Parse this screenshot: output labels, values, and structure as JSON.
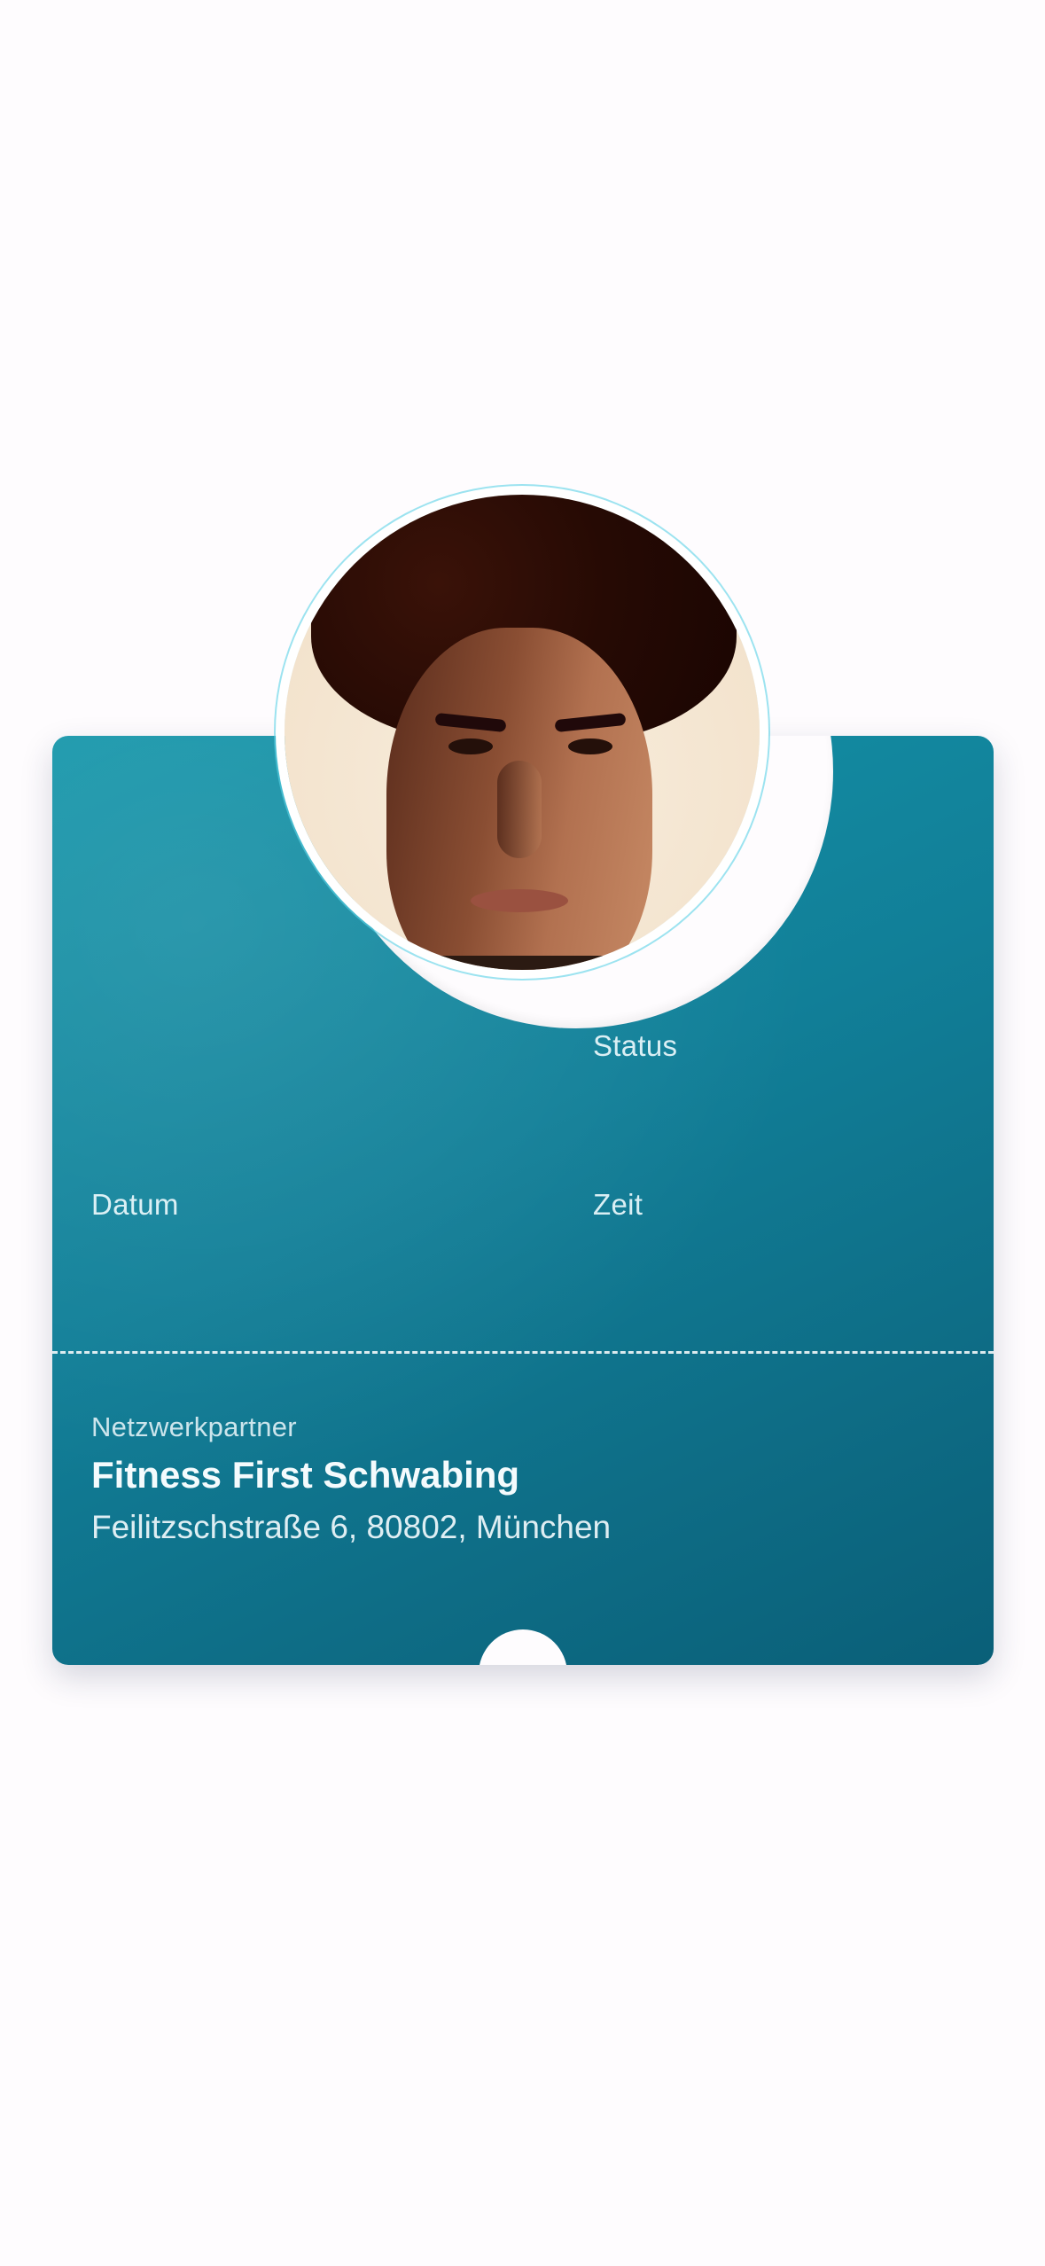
{
  "ticket": {
    "status_label": "Status",
    "datum_label": "Datum",
    "zeit_label": "Zeit",
    "partner_label": "Netzwerkpartner",
    "partner_name": "Fitness First Schwabing",
    "partner_address": "Feilitzschstraße 6, 80802, München"
  },
  "colors": {
    "card_gradient_start": "#1596aa",
    "card_gradient_end": "#0a5f78",
    "text": "#f4fbfd",
    "background": "#fefcfe"
  },
  "icons": {
    "avatar": "user-photo"
  }
}
